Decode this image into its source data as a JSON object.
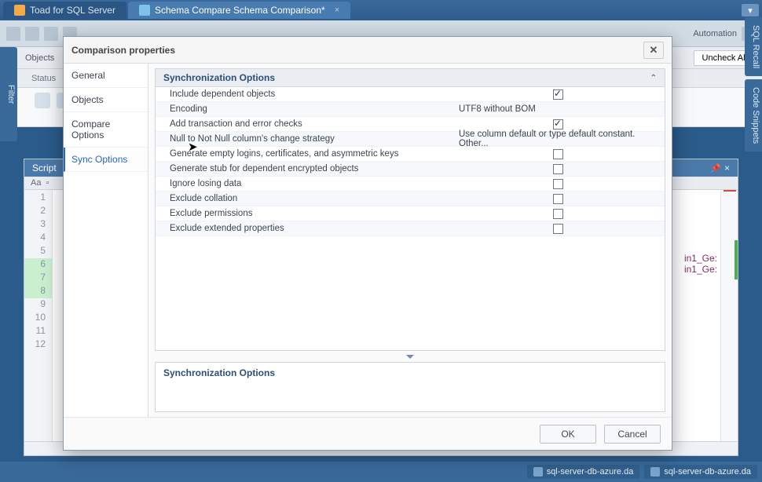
{
  "titlebar": {
    "tabs": [
      {
        "label": "Toad for SQL Server",
        "icon": "toad-icon"
      },
      {
        "label": "Schema Compare Schema Comparison*",
        "icon": "compare-icon"
      }
    ]
  },
  "toolbar": {
    "automation_label": "Automation",
    "objects_label": "Objects",
    "uncheck_all_label": "Uncheck All",
    "status_label": "Status"
  },
  "side_panels": {
    "left": "Filter",
    "right": [
      "SQL Recall",
      "Code Snippets"
    ]
  },
  "script_panel": {
    "title": "Script",
    "tool_aa": "Aa",
    "lines": [
      "1",
      "2",
      "3",
      "4",
      "5",
      "6",
      "7",
      "8",
      "9",
      "10",
      "11",
      "12"
    ],
    "highlighted": [
      6,
      7,
      8
    ],
    "right_text1": "in1_Ge:",
    "right_text2": "in1_Ge:"
  },
  "dialog": {
    "title": "Comparison properties",
    "nav": [
      "General",
      "Objects",
      "Compare Options",
      "Sync Options"
    ],
    "nav_selected_index": 3,
    "section_header": "Synchronization Options",
    "rows": [
      {
        "label": "Include dependent objects",
        "type": "check",
        "checked": true
      },
      {
        "label": "Encoding",
        "type": "text",
        "value": "UTF8 without BOM"
      },
      {
        "label": "Add transaction and error checks",
        "type": "check",
        "checked": true
      },
      {
        "label": "Null to Not Null column's change strategy",
        "type": "text",
        "value": "Use column default or type default constant. Other..."
      },
      {
        "label": "Generate empty logins, certificates, and asymmetric keys",
        "type": "check",
        "checked": false
      },
      {
        "label": "Generate stub for dependent encrypted objects",
        "type": "check",
        "checked": false
      },
      {
        "label": "Ignore losing data",
        "type": "check",
        "checked": false
      },
      {
        "label": "Exclude collation",
        "type": "check",
        "checked": false
      },
      {
        "label": "Exclude permissions",
        "type": "check",
        "checked": false
      },
      {
        "label": "Exclude extended properties",
        "type": "check",
        "checked": false
      }
    ],
    "description_title": "Synchronization Options",
    "ok_label": "OK",
    "cancel_label": "Cancel"
  },
  "statusbar": {
    "items": [
      {
        "label": "sql-server-db-azure.da"
      },
      {
        "label": "sql-server-db-azure.da"
      }
    ]
  }
}
